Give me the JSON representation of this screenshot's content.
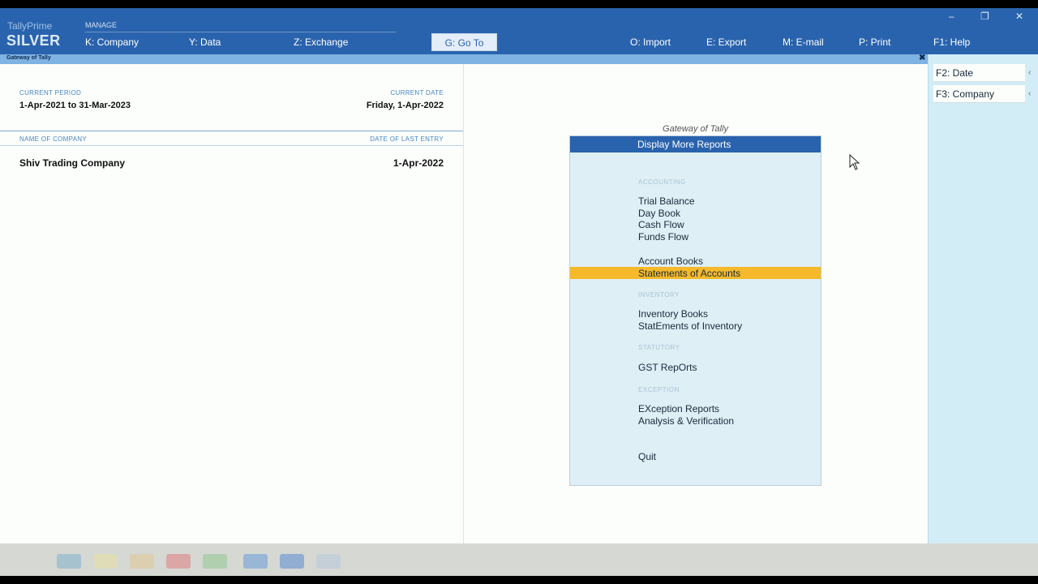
{
  "app": {
    "brand_small": "TallyPrime",
    "brand_big": "SILVER",
    "window_controls": [
      "–",
      "❐",
      "✕"
    ]
  },
  "topbar": {
    "manage_label": "MANAGE",
    "menu": [
      {
        "label": "K: Company"
      },
      {
        "label": "Y: Data"
      },
      {
        "label": "Z: Exchange"
      },
      {
        "label": "O: Import"
      },
      {
        "label": "E: Export"
      },
      {
        "label": "M: E-mail"
      },
      {
        "label": "P: Print"
      },
      {
        "label": "F1: Help"
      }
    ],
    "goto_label": "G: Go To"
  },
  "subbar": {
    "title": "Gateway of Tally",
    "close": "✖"
  },
  "info": {
    "current_period_label": "CURRENT PERIOD",
    "current_period_value": "1-Apr-2021 to 31-Mar-2023",
    "current_date_label": "CURRENT DATE",
    "current_date_value": "Friday, 1-Apr-2022",
    "company_col_label": "NAME OF COMPANY",
    "last_entry_col_label": "DATE OF LAST ENTRY",
    "company_name": "Shiv Trading Company",
    "last_entry_date": "1-Apr-2022"
  },
  "gateway": {
    "title": "Gateway of Tally",
    "header": "Display More Reports",
    "sections": {
      "accounting": "ACCOUNTING",
      "inventory": "INVENTORY",
      "statutory": "STATUTORY",
      "exception": "EXCEPTION"
    },
    "items": {
      "trial_balance": "Trial Balance",
      "day_book": "Day Book",
      "cash_flow": "Cash Flow",
      "funds_flow": "Funds Flow",
      "account_books": "Account Books",
      "statements_of_accounts": "Statements of Accounts",
      "inventory_books": "Inventory Books",
      "statements_of_inventory": "StatEments of Inventory",
      "gst_reports": "GST RepOrts",
      "exception_reports": "EXception Reports",
      "analysis_verification": "Analysis & Verification",
      "quit": "Quit"
    }
  },
  "right_panel": {
    "f2": "F2: Date",
    "f3": "F3: Company",
    "arrow": "‹"
  },
  "colors": {
    "header_blue": "#2a63ad",
    "highlight": "#f5b92b",
    "panel_bg": "#deeff6"
  }
}
